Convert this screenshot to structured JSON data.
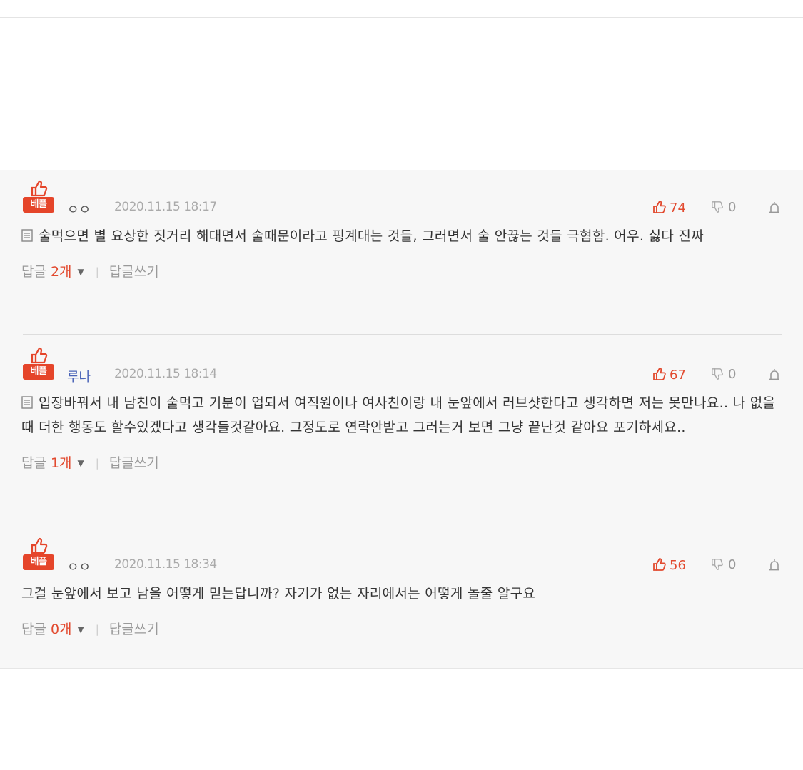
{
  "comments": [
    {
      "badge": "베플",
      "nickname": "ㅇㅇ",
      "date": "2020.11.15 18:17",
      "likes": "74",
      "dislikes": "0",
      "text": "술먹으면 별 요상한 짓거리 해대면서 술때문이라고 핑계대는 것들, 그러면서 술 안끊는 것들 극혐함. 어우. 싫다 진짜",
      "reply_label": "답글",
      "reply_count": "2개",
      "write_reply": "답글쓰기"
    },
    {
      "badge": "베플",
      "nickname": "루나",
      "date": "2020.11.15 18:14",
      "likes": "67",
      "dislikes": "0",
      "text": "입장바꿔서 내 남친이 술먹고 기분이 업되서 여직원이나 여사친이랑 내 눈앞에서 러브샷한다고 생각하면 저는 못만나요.. 나 없을때 더한 행동도 할수있겠다고 생각들것같아요. 그정도로 연락안받고 그러는거 보면 그냥 끝난것 같아요 포기하세요..",
      "reply_label": "답글",
      "reply_count": "1개",
      "write_reply": "답글쓰기"
    },
    {
      "badge": "베플",
      "nickname": "ㅇㅇ",
      "date": "2020.11.15 18:34",
      "likes": "56",
      "dislikes": "0",
      "text": "그걸 눈앞에서 보고 남을 어떻게 믿는답니까? 자기가 없는 자리에서는 어떻게 놀줄 알구요",
      "reply_label": "답글",
      "reply_count": "0개",
      "write_reply": "답글쓰기"
    }
  ],
  "colors": {
    "accent": "#e24a2f",
    "badge_bg": "#e5452a",
    "panel_bg": "#f7f7f7",
    "nickname_blue": "#4a64b8"
  }
}
